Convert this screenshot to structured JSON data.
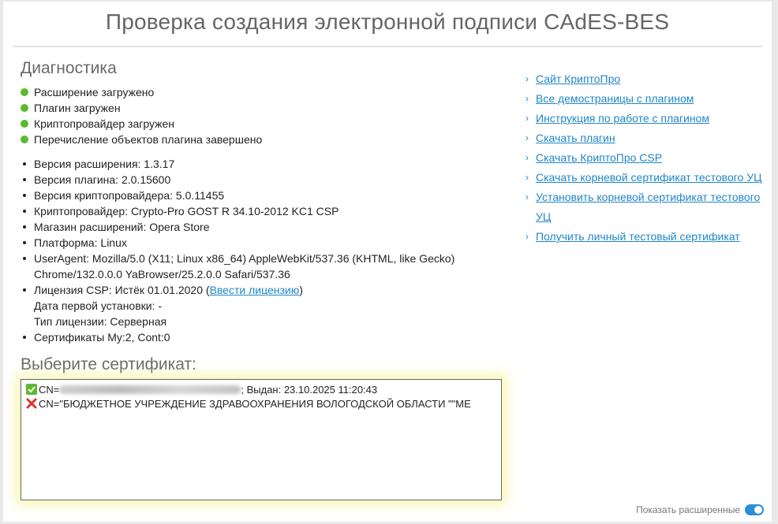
{
  "page_title": "Проверка создания электронной подписи CAdES-BES",
  "diagnostics": {
    "heading": "Диагностика",
    "status_items": [
      {
        "label": "Расширение загружено",
        "color": "#5cb930"
      },
      {
        "label": "Плагин загружен",
        "color": "#5cb930"
      },
      {
        "label": "Криптопровайдер загружен",
        "color": "#5cb930"
      },
      {
        "label": "Перечисление объектов плагина завершено",
        "color": "#5cb930"
      }
    ],
    "info": {
      "extension_version": "Версия расширения: 1.3.17",
      "plugin_version": "Версия плагина: 2.0.15600",
      "csp_version": "Версия криптопровайдера: 5.0.11455",
      "csp_name": "Криптопровайдер: Crypto-Pro GOST R 34.10-2012 KC1 CSP",
      "store": "Магазин расширений: Opera Store",
      "platform": "Платформа: Linux",
      "useragent_line1": "UserAgent: Mozilla/5.0 (X11; Linux x86_64) AppleWebKit/537.36 (KHTML, like Gecko)",
      "useragent_line2": "Chrome/132.0.0.0 YaBrowser/25.2.0.0 Safari/537.36",
      "license_prefix": "Лицензия CSP: Истёк 01.01.2020 (",
      "license_link": "Ввести лицензию",
      "license_suffix": ")",
      "first_install": "Дата первой установки: -",
      "license_type": "Тип лицензии: Серверная",
      "certificates": "Сертификаты My:2, Cont:0"
    }
  },
  "certificate_select": {
    "heading": "Выберите сертификат:",
    "items": [
      {
        "status": "valid",
        "prefix": "CN=",
        "redacted": true,
        "suffix": "; Выдан: 23.10.2025 11:20:43"
      },
      {
        "status": "invalid",
        "prefix": "CN=\"БЮДЖЕТНОЕ УЧРЕЖДЕНИЕ ЗДРАВООХРАНЕНИЯ ВОЛОГОДСКОЙ ОБЛАСТИ \"\"МЕ",
        "redacted": false,
        "suffix": ""
      }
    ]
  },
  "side_links": [
    "Сайт КриптоПро",
    "Все демостраницы с плагином",
    "Инструкция по работе с плагином",
    "Скачать плагин",
    "Скачать КриптоПро CSP",
    "Скачать корневой сертификат тестового УЦ",
    "Установить корневой сертификат тестового УЦ",
    "Получить личный тестовый сертификат"
  ],
  "advanced_toggle": {
    "label": "Показать расширенные",
    "on": true
  },
  "colors": {
    "link": "#1f86c8",
    "ok": "#5cb930",
    "error": "#d9342b",
    "toggle": "#2a8fd4"
  }
}
